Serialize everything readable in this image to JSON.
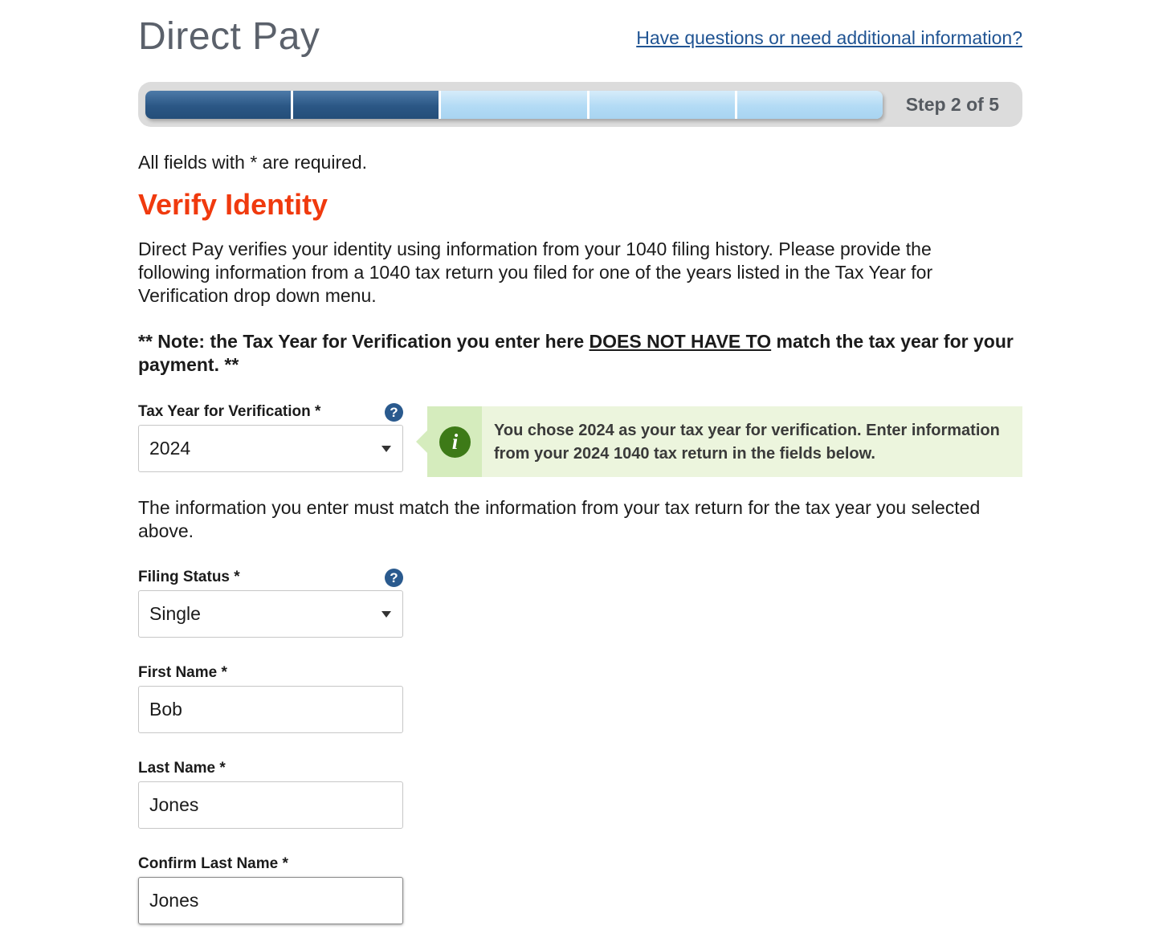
{
  "header": {
    "title": "Direct Pay",
    "help_link": "Have questions or need additional information?"
  },
  "progress": {
    "current_step": 2,
    "total_steps": 5,
    "label": "Step 2 of 5"
  },
  "colors": {
    "title_accent": "#f03a0e",
    "link": "#205493",
    "progress_done": "#2b5785",
    "progress_todo": "#b3dbf5",
    "info_bg": "#ecf5dd",
    "info_icon": "#3d7a17"
  },
  "form": {
    "required_note": "All fields with * are required.",
    "section_title": "Verify Identity",
    "intro": "Direct Pay verifies your identity using information from your 1040 filing history. Please provide the following information from a 1040 tax return you filed for one of the years listed in the Tax Year for Verification drop down menu.",
    "note": {
      "prefix": "** Note: the Tax Year for Verification you enter here ",
      "emphasis": "DOES NOT HAVE TO",
      "suffix": " match the tax year for your payment. **"
    },
    "tax_year": {
      "label": "Tax Year for Verification *",
      "value": "2024",
      "help_icon": "question-mark-icon"
    },
    "info_message": {
      "icon": "info-icon",
      "text": "You chose 2024 as your tax year for verification. Enter information from your 2024 1040 tax return in the fields below."
    },
    "match_note": "The information you enter must match the information from your tax return for the tax year you selected above.",
    "filing_status": {
      "label": "Filing Status *",
      "value": "Single",
      "help_icon": "question-mark-icon"
    },
    "first_name": {
      "label": "First Name *",
      "value": "Bob"
    },
    "last_name": {
      "label": "Last Name *",
      "value": "Jones"
    },
    "confirm_last_name": {
      "label": "Confirm Last Name *",
      "value": "Jones"
    }
  }
}
